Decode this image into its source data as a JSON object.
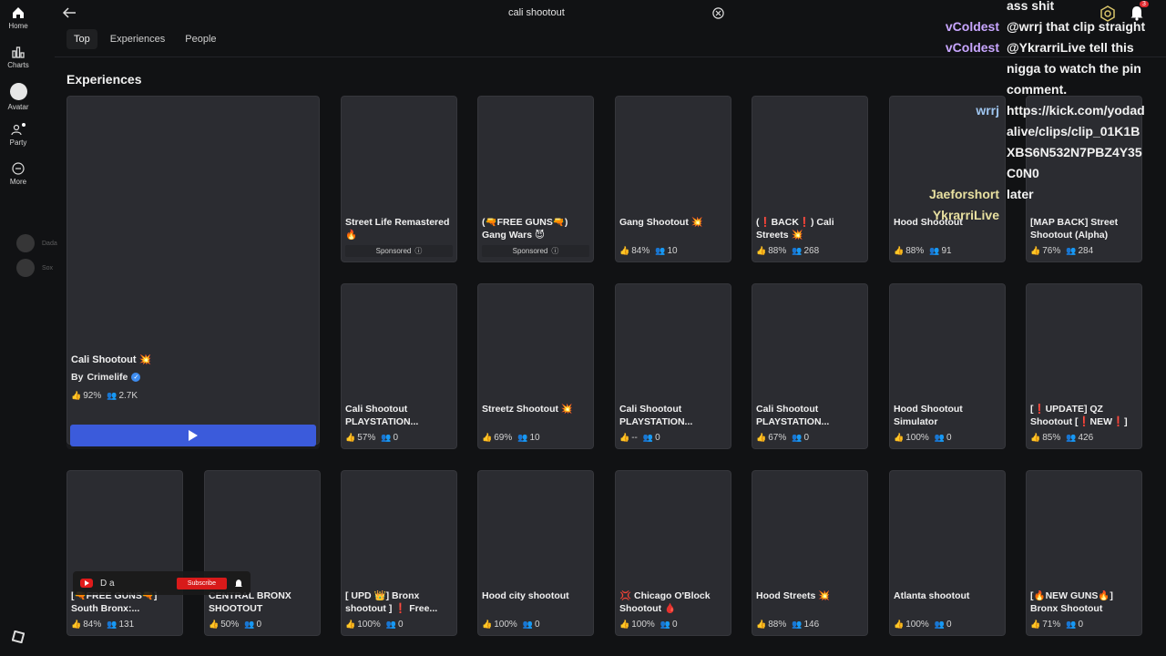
{
  "nav": {
    "items": [
      {
        "icon": "home-icon",
        "label": "Home"
      },
      {
        "icon": "charts-icon",
        "label": "Charts"
      },
      {
        "icon": "avatar-icon",
        "label": "Avatar"
      },
      {
        "icon": "party-icon",
        "label": "Party"
      },
      {
        "icon": "more-icon",
        "label": "More"
      }
    ],
    "friends": [
      {
        "name": "Dada"
      },
      {
        "name": "Sox"
      }
    ]
  },
  "search": {
    "query": "cali shootout"
  },
  "tabs": [
    {
      "label": "Top",
      "active": true
    },
    {
      "label": "Experiences",
      "active": false
    },
    {
      "label": "People",
      "active": false
    }
  ],
  "section_title": "Experiences",
  "featured": {
    "title": "Cali Shootout 💥",
    "by_label": "By",
    "creator": "Crimelife",
    "rating": "92%",
    "players": "2.7K"
  },
  "cards": [
    {
      "title": "Street Life Remastered 🔥",
      "sponsored": true
    },
    {
      "title": "(🔫FREE GUNS🔫) Gang Wars 😈",
      "sponsored": true
    },
    {
      "title": "Gang Shootout 💥",
      "rating": "84%",
      "players": "10"
    },
    {
      "title": "(❗BACK❗) Cali Streets 💥",
      "rating": "88%",
      "players": "268"
    },
    {
      "title": "Hood Shootout",
      "rating": "88%",
      "players": "91"
    },
    {
      "title": "[MAP BACK] Street Shootout (Alpha)",
      "rating": "76%",
      "players": "284"
    },
    {
      "title": "Cali Shootout PLAYSTATION...",
      "rating": "57%",
      "players": "0"
    },
    {
      "title": "Streetz Shootout 💥",
      "rating": "69%",
      "players": "10"
    },
    {
      "title": "Cali Shootout PLAYSTATION...",
      "rating": "--",
      "players": "0"
    },
    {
      "title": "Cali Shootout PLAYSTATION...",
      "rating": "67%",
      "players": "0"
    },
    {
      "title": "Hood Shootout Simulator",
      "rating": "100%",
      "players": "0"
    },
    {
      "title": "[❗UPDATE] QZ Shootout [❗NEW❗]",
      "rating": "85%",
      "players": "426"
    },
    {
      "title": "[🔫FREE GUNS🔫] South Bronx:...",
      "rating": "84%",
      "players": "131"
    },
    {
      "title": "CENTRAL BRONX SHOOTOUT",
      "rating": "50%",
      "players": "0"
    },
    {
      "title": "[ UPD 👑] Bronx shootout ] ❗ Free...",
      "rating": "100%",
      "players": "0"
    },
    {
      "title": "Hood city shootout",
      "rating": "100%",
      "players": "0"
    },
    {
      "title": "💢 Chicago O'Block Shootout 🩸",
      "rating": "100%",
      "players": "0"
    },
    {
      "title": "Hood Streets 💥",
      "rating": "88%",
      "players": "146"
    },
    {
      "title": "Atlanta shootout",
      "rating": "100%",
      "players": "0"
    },
    {
      "title": "[🔥NEW GUNS🔥] Bronx Shootout",
      "rating": "71%",
      "players": "0"
    }
  ],
  "sponsored_label": "Sponsored",
  "chat": [
    {
      "user": "",
      "text": "ass shit"
    },
    {
      "user": "vColdest",
      "text": "@wrrj that clip straight"
    },
    {
      "user": "vColdest",
      "text": "@YkrarriLive tell this"
    },
    {
      "user": "",
      "text": "nigga to watch the pin"
    },
    {
      "user": "",
      "text": "comment."
    },
    {
      "user": "wrrj",
      "text": "https://kick.com/yodad"
    },
    {
      "user": "",
      "text": "alive/clips/clip_01K1B"
    },
    {
      "user": "",
      "text": "XBS6N532N7PBZ4Y35"
    },
    {
      "user": "",
      "text": "C0N0"
    },
    {
      "user": "Jaeforshort",
      "text": "later"
    },
    {
      "user": "YkrarriLive",
      "text": ""
    }
  ],
  "notification_count": "3",
  "yt_overlay": {
    "text": "D a",
    "subscribe_label": "Subscribe"
  },
  "colors": {
    "background": "#111214",
    "card": "#2b2c31",
    "play_button": "#3b5bdb",
    "chat_username": "#c8a6ff",
    "chat_username_wrrj": "#9fc6f0"
  }
}
